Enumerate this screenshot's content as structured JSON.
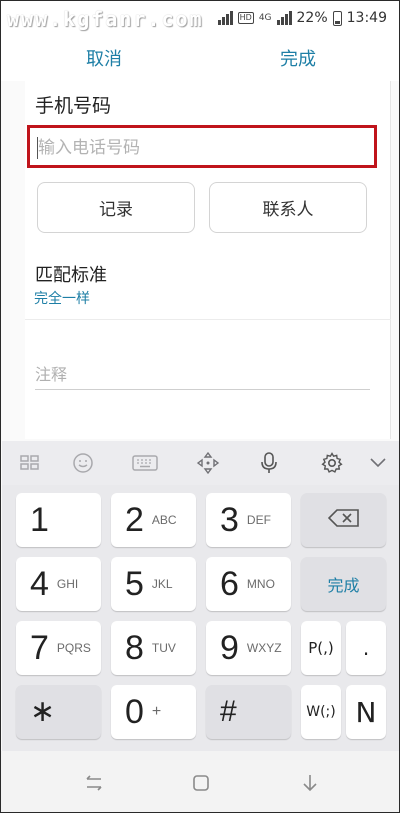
{
  "status_bar": {
    "watermark": "www.kgfanr.com",
    "network_label": "HD",
    "network_type": "4G",
    "battery": "22%",
    "time": "13:49"
  },
  "action_bar": {
    "cancel": "取消",
    "done": "完成"
  },
  "form": {
    "phone_label": "手机号码",
    "phone_value": "",
    "phone_placeholder": "输入电话号码",
    "log_button": "记录",
    "contacts_button": "联系人",
    "match_label": "匹配标准",
    "match_value": "完全一样",
    "note_placeholder": "注释"
  },
  "keyboard": {
    "toolbar_icons": [
      "grid-icon",
      "emoji-icon",
      "keyboard-icon",
      "cursor-move-icon",
      "microphone-icon",
      "gear-icon",
      "chevron-down-icon"
    ],
    "keys": {
      "k1": {
        "num": "1",
        "sub": ""
      },
      "k2": {
        "num": "2",
        "sub": "ABC"
      },
      "k3": {
        "num": "3",
        "sub": "DEF"
      },
      "k4": {
        "num": "4",
        "sub": "GHI"
      },
      "k5": {
        "num": "5",
        "sub": "JKL"
      },
      "k6": {
        "num": "6",
        "sub": "MNO"
      },
      "k7": {
        "num": "7",
        "sub": "PQRS"
      },
      "k8": {
        "num": "8",
        "sub": "TUV"
      },
      "k9": {
        "num": "9",
        "sub": "WXYZ"
      },
      "k0": {
        "num": "0",
        "sub": "+"
      },
      "star": "∗",
      "hash": "#",
      "done": "完成",
      "pause": "P(,)",
      "period": ".",
      "wait": "W(;)",
      "n": "N"
    }
  },
  "colors": {
    "accent": "#1e7fa6",
    "highlight_border": "#c0141b",
    "keyboard_bg": "#e9e9ec"
  }
}
